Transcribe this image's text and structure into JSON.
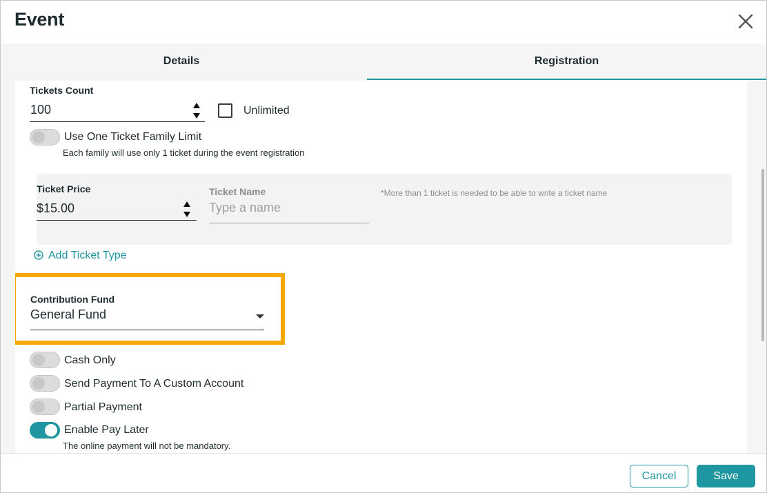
{
  "dialog": {
    "title": "Event"
  },
  "tabs": [
    {
      "label": "Details",
      "active": false
    },
    {
      "label": "Registration",
      "active": true
    }
  ],
  "tickets": {
    "count_label": "Tickets Count",
    "count_value": "100",
    "unlimited_label": "Unlimited",
    "unlimited_checked": false,
    "family_limit_label": "Use One Ticket Family Limit",
    "family_limit_on": false,
    "family_limit_hint": "Each family will use only 1 ticket during the event registration",
    "price_label": "Ticket Price",
    "price_value": "$15.00",
    "name_label": "Ticket Name",
    "name_placeholder": "Type a name",
    "name_note": "*More than 1 ticket is needed to be able to write a ticket name",
    "add_type_label": "Add Ticket Type"
  },
  "fund": {
    "label": "Contribution Fund",
    "selected": "General Fund"
  },
  "payment_toggles": [
    {
      "label": "Cash Only",
      "on": false
    },
    {
      "label": "Send Payment To A Custom Account",
      "on": false
    },
    {
      "label": "Partial Payment",
      "on": false
    },
    {
      "label": "Enable Pay Later",
      "on": true,
      "hint": "The online payment will not be mandatory."
    }
  ],
  "footer": {
    "cancel_label": "Cancel",
    "save_label": "Save"
  },
  "colors": {
    "accent": "#1f97a1",
    "highlight": "#f6a800"
  }
}
